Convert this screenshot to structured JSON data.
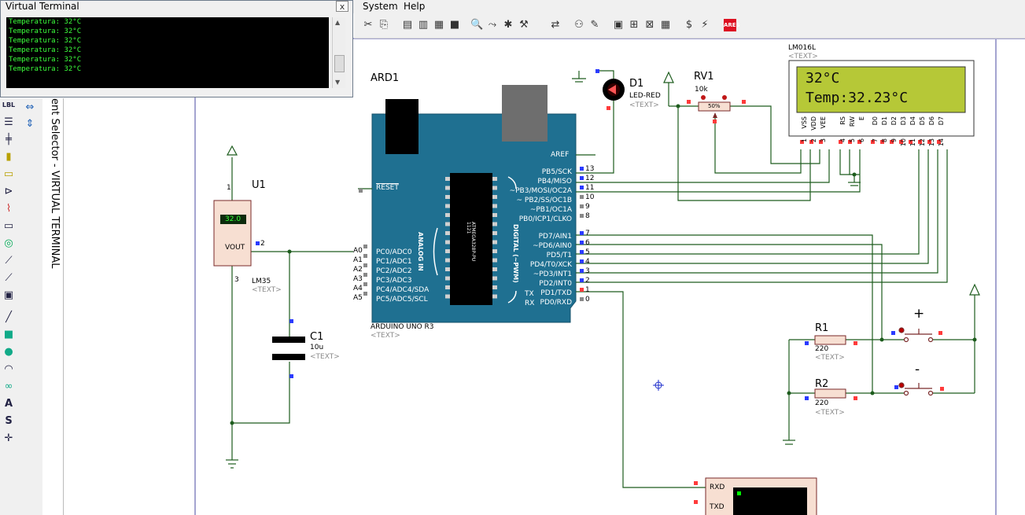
{
  "menu": {
    "system": "System",
    "help": "Help"
  },
  "virtual_terminal": {
    "title": "Virtual Terminal",
    "close_label": "x",
    "lines": [
      "Temperatura: 32°C",
      "Temperatura: 32°C",
      "Temperatura: 32°C",
      "Temperatura: 32°C",
      "Temperatura: 32°C",
      "Temperatura: 32°C"
    ]
  },
  "sidebar": {
    "device_selector_label": "ent Selector - VIRTUAL TERMINAL"
  },
  "schematic": {
    "arduino": {
      "ref": "ARD1",
      "part": "ARDUINO UNO R3",
      "text": "<TEXT>",
      "aref": "AREF",
      "reset": "RESET",
      "analog_label": "ANALOG IN",
      "digital_label": "DIGITAL (~PWM)",
      "chip_label": "ATMEGA328P-PU",
      "chip_num": "1121",
      "analog_pins": [
        "PC0/ADC0",
        "PC1/ADC1",
        "PC2/ADC2",
        "PC3/ADC3",
        "PC4/ADC4/SDA",
        "PC5/ADC5/SCL"
      ],
      "analog_nums": [
        "A0",
        "A1",
        "A2",
        "A3",
        "A4",
        "A5"
      ],
      "digital_pins": [
        "PB5/SCK",
        "PB4/MISO",
        "~PB3/MOSI/OC2A",
        "~ PB2/SS/OC1B",
        "~PB1/OC1A",
        "PB0/ICP1/CLKO",
        "PD7/AIN1",
        "~PD6/AIN0",
        "PD5/T1",
        "PD4/T0/XCK",
        "~PD3/INT1",
        "PD2/INT0",
        "PD1/TXD",
        "PD0/RXD"
      ],
      "digital_nums": [
        "13",
        "12",
        "11",
        "10",
        "9",
        "8",
        "7",
        "6",
        "5",
        "4",
        "3",
        "2",
        "1",
        "0"
      ],
      "tx": "TX",
      "rx": "RX"
    },
    "u1": {
      "ref": "U1",
      "part": "LM35",
      "text": "<TEXT>",
      "display": "32.0",
      "vout": "VOUT",
      "pin1": "1",
      "pin2": "2",
      "pin3": "3"
    },
    "c1": {
      "ref": "C1",
      "value": "10u",
      "text": "<TEXT>"
    },
    "d1": {
      "ref": "D1",
      "part": "LED-RED",
      "text": "<TEXT>"
    },
    "rv1": {
      "ref": "RV1",
      "value": "10k",
      "percent": "50%"
    },
    "lcd": {
      "part": "LM016L",
      "text": "<TEXT>",
      "line1": "32°C",
      "line2": "Temp:32.23°C",
      "pins": [
        "VSS",
        "VDD",
        "VEE",
        "RS",
        "RW",
        "E",
        "D0",
        "D1",
        "D2",
        "D3",
        "D4",
        "D5",
        "D6",
        "D7"
      ],
      "pin_nums": [
        "1",
        "2",
        "3",
        "4",
        "5",
        "6",
        "7",
        "8",
        "9",
        "10",
        "11",
        "12",
        "13",
        "14"
      ]
    },
    "r1": {
      "ref": "R1",
      "value": "220",
      "text": "<TEXT>"
    },
    "r2": {
      "ref": "R2",
      "value": "220",
      "text": "<TEXT>"
    },
    "buttons": {
      "plus": "+",
      "minus": "-"
    },
    "terminal": {
      "rxd": "RXD",
      "txd": "TXD"
    }
  },
  "colors": {
    "wire": "#1d5c1d",
    "board": "#1f7091",
    "lcd_bg": "#b6c837",
    "pin_red": "#ff3b3b",
    "pin_blue": "#2b3bff"
  }
}
